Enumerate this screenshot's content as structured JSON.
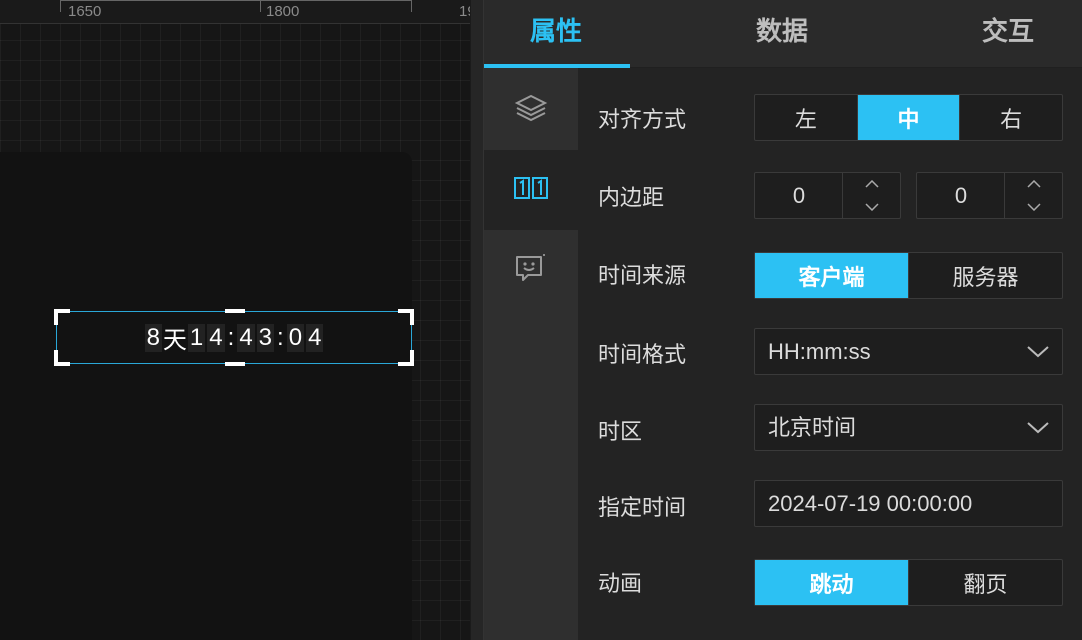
{
  "ruler": {
    "labels": [
      "1650",
      "1800",
      "19"
    ]
  },
  "countdown": {
    "days": "8",
    "days_unit": "天",
    "hours": [
      "1",
      "4"
    ],
    "minutes": [
      "4",
      "3"
    ],
    "seconds": [
      "0",
      "4"
    ],
    "separator": ":"
  },
  "tabs": [
    {
      "label": "属性",
      "active": true
    },
    {
      "label": "数据",
      "active": false
    },
    {
      "label": "交互",
      "active": false
    }
  ],
  "sidebar": {
    "items": [
      {
        "icon": "layers-icon",
        "active": false
      },
      {
        "icon": "digits-icon",
        "label": "11",
        "active": true
      },
      {
        "icon": "chat-face-icon",
        "active": false
      }
    ]
  },
  "props": {
    "align": {
      "label": "对齐方式",
      "options": [
        "左",
        "中",
        "右"
      ],
      "selected": "中"
    },
    "padding": {
      "label": "内边距",
      "left_value": "0",
      "right_value": "0"
    },
    "time_source": {
      "label": "时间来源",
      "options": [
        "客户端",
        "服务器"
      ],
      "selected": "客户端"
    },
    "time_format": {
      "label": "时间格式",
      "value": "HH:mm:ss"
    },
    "timezone": {
      "label": "时区",
      "value": "北京时间"
    },
    "target_time": {
      "label": "指定时间",
      "value": "2024-07-19 00:00:00"
    },
    "animation": {
      "label": "动画",
      "options": [
        "跳动",
        "翻页"
      ],
      "selected": "跳动"
    }
  },
  "colors": {
    "accent": "#2cc1f3",
    "selection": "#2aa7d8"
  }
}
